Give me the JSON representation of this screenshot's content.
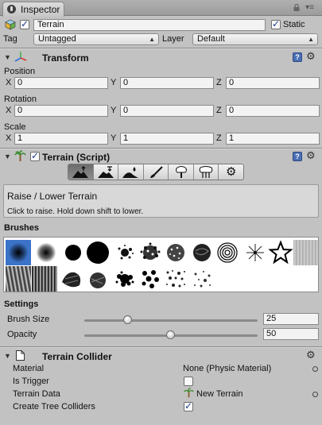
{
  "tab": {
    "label": "Inspector"
  },
  "header": {
    "active": true,
    "name": "Terrain",
    "static_label": "Static",
    "static_checked": true,
    "tag_label": "Tag",
    "tag_value": "Untagged",
    "layer_label": "Layer",
    "layer_value": "Default"
  },
  "transform": {
    "title": "Transform",
    "position_label": "Position",
    "rotation_label": "Rotation",
    "scale_label": "Scale",
    "position": {
      "x": "0",
      "y": "0",
      "z": "0"
    },
    "rotation": {
      "x": "0",
      "y": "0",
      "z": "0"
    },
    "scale": {
      "x": "1",
      "y": "1",
      "z": "1"
    },
    "axis_x": "X",
    "axis_y": "Y",
    "axis_z": "Z"
  },
  "terrain_script": {
    "title": "Terrain (Script)",
    "enabled": true,
    "tools": [
      "raise-lower",
      "paint-height",
      "smooth-height",
      "paint-texture",
      "place-trees",
      "paint-details",
      "settings"
    ],
    "active_tool": "raise-lower",
    "help_title": "Raise / Lower Terrain",
    "help_text": "Click to raise. Hold down shift to lower.",
    "brushes_label": "Brushes",
    "brush_count": 20,
    "selected_brush": 0,
    "settings_label": "Settings",
    "brush_size_label": "Brush Size",
    "brush_size_value": "25",
    "brush_size_fraction": 0.25,
    "opacity_label": "Opacity",
    "opacity_value": "50",
    "opacity_fraction": 0.5
  },
  "collider": {
    "title": "Terrain Collider",
    "material_label": "Material",
    "material_value": "None (Physic Material)",
    "trigger_label": "Is Trigger",
    "trigger_checked": false,
    "data_label": "Terrain Data",
    "data_value": "New Terrain",
    "trees_label": "Create Tree Colliders",
    "trees_checked": true
  },
  "colors": {
    "selection": "#3b73c9",
    "panel": "#c2c2c2"
  }
}
